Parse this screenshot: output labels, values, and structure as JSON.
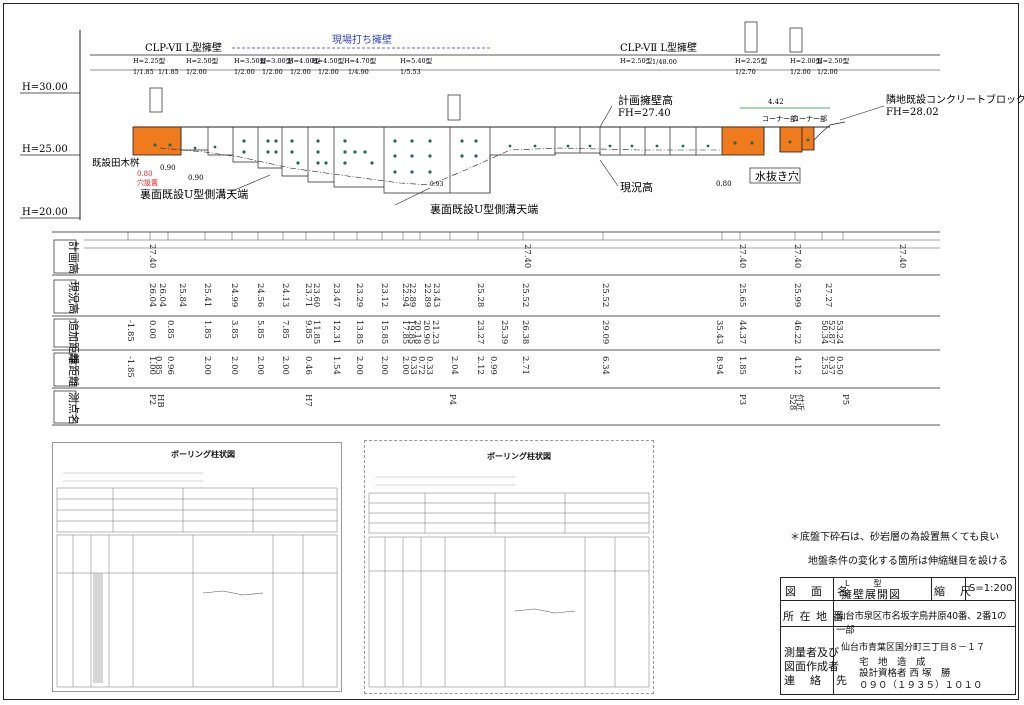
{
  "header": {
    "left_type": "CLP-VⅡ L型擁壁",
    "right_type": "CLP-VⅡ L型擁壁",
    "cast_in_place": "現場打ち擁壁",
    "left_small": [
      "H=2.25型",
      "H=2.50型",
      "H=3.50型",
      "H=3.00型",
      "H=4.00型",
      "H=4.50型",
      "H=4.70型",
      "H=5.10型",
      "H=5.40型"
    ],
    "left_ratio": [
      "1/1.85",
      "1/1.85",
      "1/2.00",
      "1/2.00",
      "1/2.00",
      "1/2.00",
      "1/2.00",
      "1/4.90",
      "1/5.53"
    ],
    "right_small": [
      "H=2.50型",
      "H=2.25型",
      "H=2.00型",
      "H=2.50型"
    ],
    "right_ratio": [
      "1/48.00",
      "1/2.70",
      "1/2.00",
      "1/2.00"
    ],
    "corner1": "コーナー部",
    "corner2": "コーナー部",
    "dim_width": "4.42"
  },
  "levels": {
    "h30": "H=30.00",
    "h25": "H=25.00",
    "h20": "H=20.00"
  },
  "callouts": {
    "existing_tree": "既設田木桝",
    "plan_wall_height": "計画擁壁高",
    "fh_plan": "FH=27.40",
    "adjacent": "隣地既設コンクリートブロック高",
    "fh_adjacent": "FH=28.02",
    "drain": "水抜き穴",
    "current_height": "現況高",
    "back_ditch1": "裏面既設U型側溝天端",
    "back_ditch2": "裏面既設U型側溝天端",
    "hole_red": "0.80",
    "hole_red2": "穴設置",
    "val_090": "0.90",
    "val_080": "0.80",
    "val_093": "0.93"
  },
  "table": {
    "row_labels": [
      "計画高",
      "現況高",
      "追加距離",
      "単距離",
      "測点名"
    ],
    "plan": [
      "27.40",
      "27.40",
      "27.40",
      "27.40",
      "27.40"
    ],
    "current": [
      "26.04",
      "26.04",
      "25.84",
      "25.41",
      "24.99",
      "24.56",
      "24.13",
      "23.71",
      "23.60",
      "23.47",
      "23.29",
      "23.12",
      "22.94",
      "22.89",
      "22.89",
      "23.43",
      "25.28",
      "25.52",
      "25.52",
      "25.65",
      "25.99",
      "27.27"
    ],
    "cum": [
      "-1.85",
      "0.00",
      "0.85",
      "1.85",
      "3.85",
      "5.85",
      "7.85",
      "9.85",
      "11.85",
      "12.31",
      "13.85",
      "15.85",
      "17.85",
      "19.85",
      "20.18",
      "20.90",
      "21.23",
      "23.27",
      "25.39",
      "26.38",
      "29.09",
      "35.43",
      "44.37",
      "46.22",
      "50.34",
      "52.87",
      "53.24",
      "53.74"
    ],
    "single": [
      "-1.85",
      "1.00",
      "0.85",
      "0.96",
      "2.00",
      "2.00",
      "2.00",
      "2.00",
      "0.46",
      "1.54",
      "2.00",
      "2.00",
      "2.00",
      "0.33",
      "0.72",
      "0.33",
      "2.04",
      "2.12",
      "0.99",
      "2.71",
      "6.34",
      "8.94",
      "1.85",
      "4.12",
      "2.53",
      "0.37",
      "0.50"
    ],
    "points": [
      "P2",
      "HB",
      "H7",
      "P4",
      "P3",
      "528",
      "付近",
      "P5"
    ]
  },
  "boring": [
    {
      "title": "ボーリング柱状図"
    },
    {
      "title": "ボーリング柱状図"
    }
  ],
  "notes": {
    "n1": "＊底盤下砕石は、砂岩層の為設置無くても良い",
    "n2": "地盤条件の変化する箇所は伸縮継目を設ける"
  },
  "titleblock": {
    "drawing_name_label": "図　面　名",
    "drawing_name_top": "L　　　型",
    "drawing_name": "擁壁展開図",
    "scale_label": "縮　尺",
    "scale": "S=1:200",
    "location_label": "所 在 地 番",
    "location": "仙台市泉区市名坂字鳥井原40番、2番1の一部",
    "surveyor_label1": "測量者及び",
    "surveyor_label2": "図面作成者",
    "surveyor_label3": "連　絡　先",
    "address": "仙台市青葉区国分町三丁目８－１７",
    "company1": "宅　地　造　成",
    "company2": "設計資格者 西 塚　勝",
    "phone": "０９０（１９３５）１０１０"
  },
  "colors": {
    "orange": "#f07a1c",
    "blue": "#3344cc",
    "dot": "#1d6b52",
    "red": "#e0201a"
  }
}
